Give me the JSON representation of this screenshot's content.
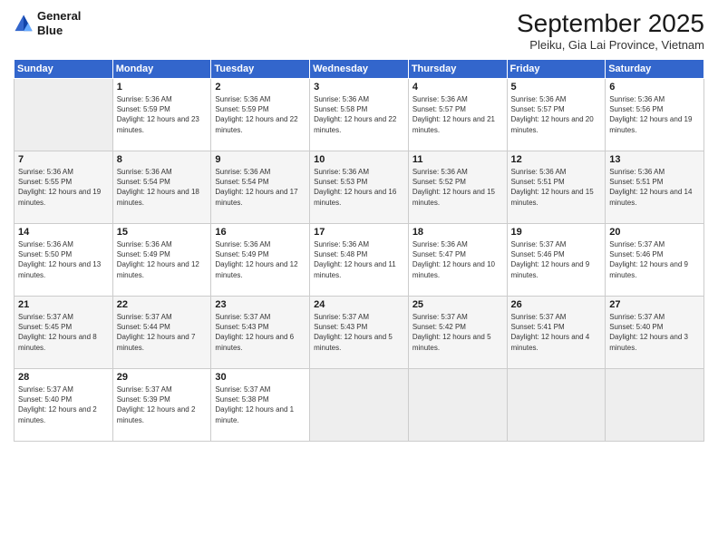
{
  "header": {
    "logo_line1": "General",
    "logo_line2": "Blue",
    "month": "September 2025",
    "location": "Pleiku, Gia Lai Province, Vietnam"
  },
  "weekdays": [
    "Sunday",
    "Monday",
    "Tuesday",
    "Wednesday",
    "Thursday",
    "Friday",
    "Saturday"
  ],
  "weeks": [
    [
      {
        "day": "",
        "empty": true
      },
      {
        "day": "1",
        "sunrise": "5:36 AM",
        "sunset": "5:59 PM",
        "daylight": "12 hours and 23 minutes."
      },
      {
        "day": "2",
        "sunrise": "5:36 AM",
        "sunset": "5:59 PM",
        "daylight": "12 hours and 22 minutes."
      },
      {
        "day": "3",
        "sunrise": "5:36 AM",
        "sunset": "5:58 PM",
        "daylight": "12 hours and 22 minutes."
      },
      {
        "day": "4",
        "sunrise": "5:36 AM",
        "sunset": "5:57 PM",
        "daylight": "12 hours and 21 minutes."
      },
      {
        "day": "5",
        "sunrise": "5:36 AM",
        "sunset": "5:57 PM",
        "daylight": "12 hours and 20 minutes."
      },
      {
        "day": "6",
        "sunrise": "5:36 AM",
        "sunset": "5:56 PM",
        "daylight": "12 hours and 19 minutes."
      }
    ],
    [
      {
        "day": "7",
        "sunrise": "5:36 AM",
        "sunset": "5:55 PM",
        "daylight": "12 hours and 19 minutes."
      },
      {
        "day": "8",
        "sunrise": "5:36 AM",
        "sunset": "5:54 PM",
        "daylight": "12 hours and 18 minutes."
      },
      {
        "day": "9",
        "sunrise": "5:36 AM",
        "sunset": "5:54 PM",
        "daylight": "12 hours and 17 minutes."
      },
      {
        "day": "10",
        "sunrise": "5:36 AM",
        "sunset": "5:53 PM",
        "daylight": "12 hours and 16 minutes."
      },
      {
        "day": "11",
        "sunrise": "5:36 AM",
        "sunset": "5:52 PM",
        "daylight": "12 hours and 15 minutes."
      },
      {
        "day": "12",
        "sunrise": "5:36 AM",
        "sunset": "5:51 PM",
        "daylight": "12 hours and 15 minutes."
      },
      {
        "day": "13",
        "sunrise": "5:36 AM",
        "sunset": "5:51 PM",
        "daylight": "12 hours and 14 minutes."
      }
    ],
    [
      {
        "day": "14",
        "sunrise": "5:36 AM",
        "sunset": "5:50 PM",
        "daylight": "12 hours and 13 minutes."
      },
      {
        "day": "15",
        "sunrise": "5:36 AM",
        "sunset": "5:49 PM",
        "daylight": "12 hours and 12 minutes."
      },
      {
        "day": "16",
        "sunrise": "5:36 AM",
        "sunset": "5:49 PM",
        "daylight": "12 hours and 12 minutes."
      },
      {
        "day": "17",
        "sunrise": "5:36 AM",
        "sunset": "5:48 PM",
        "daylight": "12 hours and 11 minutes."
      },
      {
        "day": "18",
        "sunrise": "5:36 AM",
        "sunset": "5:47 PM",
        "daylight": "12 hours and 10 minutes."
      },
      {
        "day": "19",
        "sunrise": "5:37 AM",
        "sunset": "5:46 PM",
        "daylight": "12 hours and 9 minutes."
      },
      {
        "day": "20",
        "sunrise": "5:37 AM",
        "sunset": "5:46 PM",
        "daylight": "12 hours and 9 minutes."
      }
    ],
    [
      {
        "day": "21",
        "sunrise": "5:37 AM",
        "sunset": "5:45 PM",
        "daylight": "12 hours and 8 minutes."
      },
      {
        "day": "22",
        "sunrise": "5:37 AM",
        "sunset": "5:44 PM",
        "daylight": "12 hours and 7 minutes."
      },
      {
        "day": "23",
        "sunrise": "5:37 AM",
        "sunset": "5:43 PM",
        "daylight": "12 hours and 6 minutes."
      },
      {
        "day": "24",
        "sunrise": "5:37 AM",
        "sunset": "5:43 PM",
        "daylight": "12 hours and 5 minutes."
      },
      {
        "day": "25",
        "sunrise": "5:37 AM",
        "sunset": "5:42 PM",
        "daylight": "12 hours and 5 minutes."
      },
      {
        "day": "26",
        "sunrise": "5:37 AM",
        "sunset": "5:41 PM",
        "daylight": "12 hours and 4 minutes."
      },
      {
        "day": "27",
        "sunrise": "5:37 AM",
        "sunset": "5:40 PM",
        "daylight": "12 hours and 3 minutes."
      }
    ],
    [
      {
        "day": "28",
        "sunrise": "5:37 AM",
        "sunset": "5:40 PM",
        "daylight": "12 hours and 2 minutes."
      },
      {
        "day": "29",
        "sunrise": "5:37 AM",
        "sunset": "5:39 PM",
        "daylight": "12 hours and 2 minutes."
      },
      {
        "day": "30",
        "sunrise": "5:37 AM",
        "sunset": "5:38 PM",
        "daylight": "12 hours and 1 minute."
      },
      {
        "day": "",
        "empty": true
      },
      {
        "day": "",
        "empty": true
      },
      {
        "day": "",
        "empty": true
      },
      {
        "day": "",
        "empty": true
      }
    ]
  ]
}
